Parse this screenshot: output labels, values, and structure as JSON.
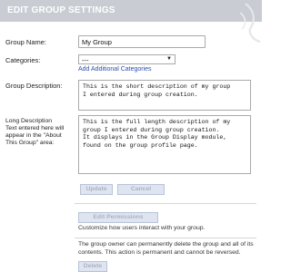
{
  "header": {
    "title": "EDIT GROUP SETTINGS"
  },
  "form": {
    "group_name": {
      "label": "Group Name:",
      "value": "My Group"
    },
    "categories": {
      "label": "Categories:",
      "value": "---",
      "add_link": "Add Additional Categories"
    },
    "group_description": {
      "label": "Group Description:",
      "value": "This is the short description of my group\nI entered during group creation."
    },
    "long_description": {
      "label": "Long Description\nText entered here will\nappear in the \"About\nThis Group\" area:",
      "value": "This is the full length description of my\ngroup I entered during group creation.\nIt displays in the Group Display module,\nfound on the group profile page."
    }
  },
  "buttons": {
    "update": "Update",
    "cancel": "Cancel",
    "edit_permissions": "Edit Permissions",
    "delete": "Delete"
  },
  "permissions_note": "Customize how users interact with your group.",
  "delete_note": "The group owner can permanently delete the group and all of its contents. This action is permanent and cannot be reversed.",
  "colors": {
    "header_bg": "#c9ccd3",
    "link": "#2a4fb0",
    "button_bg": "#dfe5f0",
    "button_text": "#aab2c4"
  }
}
